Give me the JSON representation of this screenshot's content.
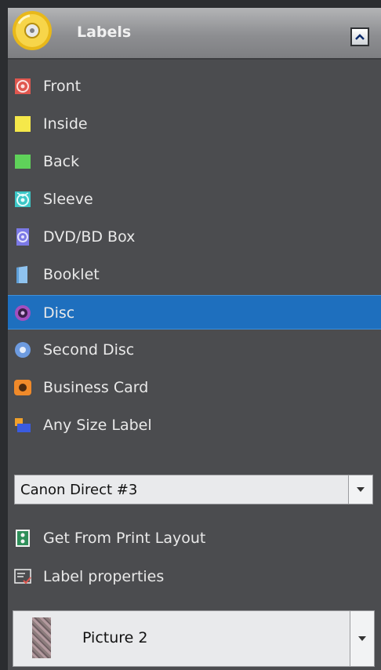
{
  "header": {
    "title": "Labels",
    "cd_icon": "cd-disc-icon",
    "collapse_icon": "chevron-up-icon"
  },
  "labels": [
    {
      "label": "Front",
      "icon": "front-label-icon",
      "color": "#e0574f"
    },
    {
      "label": "Inside",
      "icon": "inside-label-icon",
      "color": "#f5e84a"
    },
    {
      "label": "Back",
      "icon": "back-label-icon",
      "color": "#5fd25a"
    },
    {
      "label": "Sleeve",
      "icon": "sleeve-label-icon",
      "color": "#3cc7c7"
    },
    {
      "label": "DVD/BD Box",
      "icon": "dvd-box-label-icon",
      "color": "#7b79e6"
    },
    {
      "label": "Booklet",
      "icon": "booklet-label-icon",
      "color": "#8fc3ef"
    },
    {
      "label": "Disc",
      "icon": "disc-label-icon",
      "color": "#a24fbf",
      "selected": true
    },
    {
      "label": "Second Disc",
      "icon": "second-disc-label-icon",
      "color": "#6d9be0"
    },
    {
      "label": "Business Card",
      "icon": "business-card-label-icon",
      "color": "#f08a2a"
    },
    {
      "label": "Any Size Label",
      "icon": "any-size-label-icon",
      "color": "#3a5be0"
    }
  ],
  "printer_dropdown": {
    "value": "Canon Direct #3",
    "arrow_icon": "chevron-down-icon"
  },
  "actions": [
    {
      "label": "Get From Print Layout",
      "icon": "print-layout-icon"
    },
    {
      "label": "Label properties",
      "icon": "label-properties-icon"
    }
  ],
  "picture_dropdown": {
    "value": "Picture 2",
    "thumb_icon": "picture-thumbnail",
    "arrow_icon": "chevron-down-icon"
  },
  "colors": {
    "panel_bg": "#4b4c4f",
    "selected_bg": "#1e6fbe",
    "text": "#e9e9e9"
  }
}
